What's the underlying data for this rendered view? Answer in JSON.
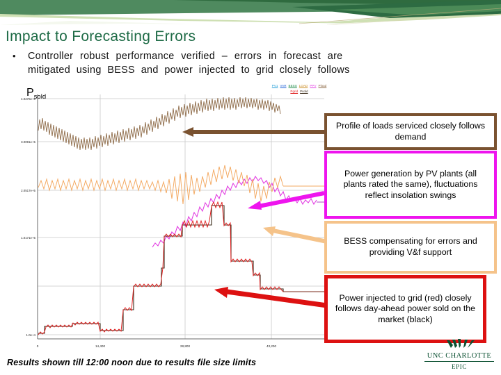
{
  "slide": {
    "title": "Impact to Forecasting Errors",
    "title_color": "#1e6b46",
    "bullet": {
      "marker": "•",
      "line1": "Controller  robust  performance  verified  –  errors  in  forecast  are",
      "line2": "mitigated  using  BESS  and  power  injected  to  grid  closely  follows",
      "line3": " "
    },
    "footnote": "Results shown till 12:00 noon due to results file size limits"
  },
  "plot": {
    "series_label": "P",
    "series_label_sub": "sold",
    "legend_row1": [
      "PV1",
      "VAR",
      "BESS",
      "LOAD",
      "PPV",
      "Pload"
    ],
    "legend_row2": [
      "Pgrid",
      "Psold"
    ],
    "x_ticks": [
      "0",
      "14,400",
      "28,800",
      "43,200"
    ],
    "y_ticks": [
      "4.0276e+5",
      "3.0091e+5",
      "2.0517e+5",
      "1.0171e+5",
      "1.0e+4"
    ]
  },
  "callouts": [
    {
      "id": "brown",
      "color": "#7a5230",
      "text": "Profile of loads serviced closely follows demand"
    },
    {
      "id": "magenta",
      "color": "#ee14ee",
      "text": "Power generation by PV plants (all plants rated the same), fluctuations reflect insolation swings"
    },
    {
      "id": "orange",
      "color": "#f5c38a",
      "text": "BESS compensating for errors and providing V&f support"
    },
    {
      "id": "red",
      "color": "#dd1111",
      "text": "Power injected to grid (red) closely follows day-ahead power sold on the market (black)"
    }
  ],
  "logo": {
    "university": "UNC CHARLOTTE",
    "center": "EPIC"
  },
  "chart_data": {
    "type": "line",
    "title": "",
    "xlabel": "",
    "ylabel": "",
    "xlim": [
      0,
      43200
    ],
    "ylim": [
      10000,
      420000
    ],
    "grid": true,
    "legend": "top-right",
    "x_tick_values": [
      0,
      14400,
      28800,
      43200
    ],
    "y_tick_values": [
      402760,
      300910,
      205170,
      101710,
      10000
    ],
    "series": [
      {
        "name": "Pload",
        "color": "#8a6642",
        "description": "noisy load profile, dips mid-morning then rises steadily through noon",
        "x": [
          0,
          2000,
          4500,
          7000,
          9500,
          12000,
          14400,
          17000,
          19500,
          22000,
          24500,
          26500,
          28800
        ],
        "values": [
          352000,
          344000,
          336000,
          330000,
          332000,
          338000,
          346000,
          358000,
          372000,
          386000,
          394000,
          398000,
          396000
        ],
        "noise": 9000
      },
      {
        "name": "PPV",
        "color": "#e23ce2",
        "description": "PV generation bell curve peaking near mid-day",
        "x": [
          0,
          6000,
          9000,
          12000,
          14400,
          17000,
          19500,
          21500,
          23000,
          25000,
          27000,
          28800
        ],
        "values": [
          101000,
          101500,
          104000,
          118000,
          140000,
          168000,
          196000,
          212000,
          206000,
          186000,
          164000,
          158000
        ],
        "noise": 6000
      },
      {
        "name": "BESS",
        "color": "#f3a860",
        "description": "battery output, flat then strongly fluctuating after mid-day",
        "x": [
          0,
          5000,
          10000,
          14400,
          17000,
          19000,
          21000,
          22500,
          24000,
          25500,
          27000,
          28800
        ],
        "values": [
          178000,
          177000,
          178000,
          177000,
          172000,
          160000,
          178000,
          190000,
          176000,
          168000,
          160000,
          172000
        ],
        "noise": 7000
      },
      {
        "name": "Pgrid",
        "color": "#e01b1b",
        "description": "power injected to grid, stepped hourly blocks with noise",
        "x": [
          0,
          2400,
          4800,
          7200,
          9600,
          12000,
          14400,
          16800,
          19200,
          21600,
          24000,
          26400,
          28800
        ],
        "values": [
          22000,
          34000,
          38000,
          42000,
          40000,
          34000,
          66000,
          96000,
          96000,
          150000,
          176000,
          118000,
          96000
        ],
        "noise": 4000
      },
      {
        "name": "Psold",
        "color": "#3a2a18",
        "description": "day-ahead power sold on market, ideal stepped reference overlapping Pgrid",
        "x": [
          0,
          2400,
          4800,
          7200,
          9600,
          12000,
          14400,
          16800,
          19200,
          21600,
          24000,
          26400,
          28800
        ],
        "values": [
          22000,
          34000,
          38000,
          42000,
          40000,
          34000,
          66000,
          96000,
          96000,
          150000,
          176000,
          118000,
          96000
        ],
        "noise": 0
      }
    ],
    "annotations": [
      {
        "text": "Profile of loads serviced closely follows demand",
        "points_to": "Pload",
        "color": "#7a5230"
      },
      {
        "text": "Power generation by PV plants (all plants rated the same), fluctuations reflect insolation swings",
        "points_to": "PPV",
        "color": "#ee14ee"
      },
      {
        "text": "BESS compensating for errors and providing V&f support",
        "points_to": "BESS",
        "color": "#f5c38a"
      },
      {
        "text": "Power injected to grid (red) closely follows day-ahead power sold on the market (black)",
        "points_to": "Pgrid",
        "color": "#dd1111"
      }
    ]
  }
}
